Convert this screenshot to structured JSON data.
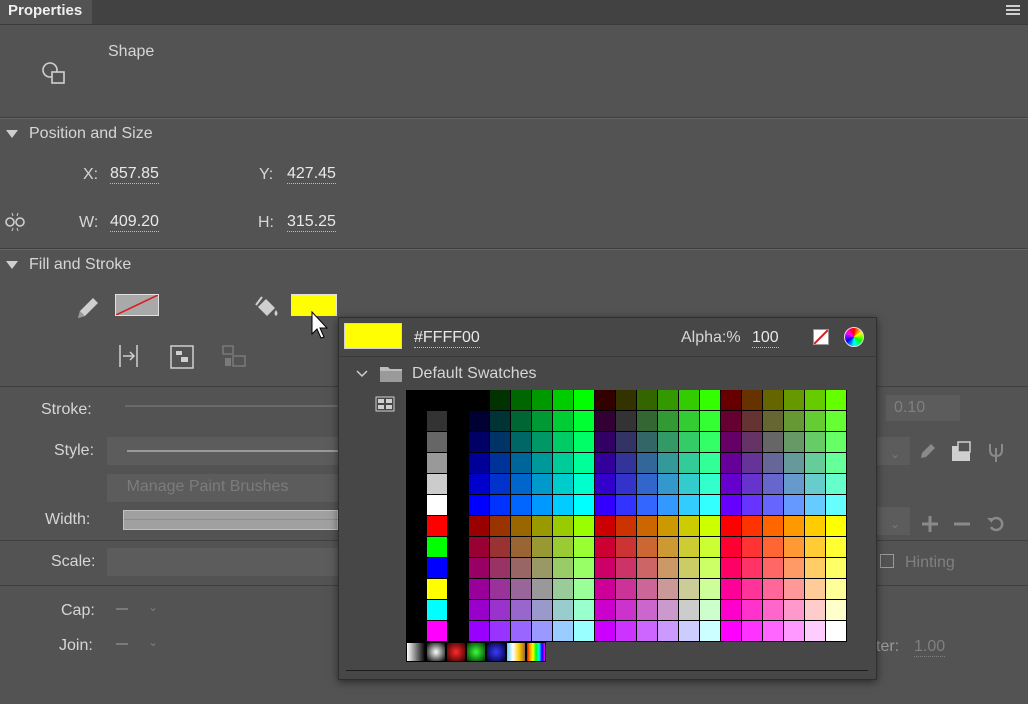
{
  "tab": {
    "title": "Properties"
  },
  "object": {
    "type_label": "Shape"
  },
  "position_size": {
    "section_title": "Position and Size",
    "x_label": "X:",
    "x_value": "857.85",
    "y_label": "Y:",
    "y_value": "427.45",
    "w_label": "W:",
    "w_value": "409.20",
    "h_label": "H:",
    "h_value": "315.25"
  },
  "fill_stroke": {
    "section_title": "Fill and Stroke",
    "stroke_label": "Stroke:",
    "stroke_value": "0.10",
    "style_label": "Style:",
    "manage_brushes": "Manage Paint Brushes",
    "width_label": "Width:",
    "scale_label": "Scale:",
    "hinting_label": "Hinting",
    "cap_label": "Cap:",
    "join_label": "Join:",
    "miter_label": "ter:",
    "miter_value": "1.00",
    "fill_color": "#FFFF00"
  },
  "swatch_popup": {
    "hex_value": "#FFFF00",
    "alpha_label": "Alpha:%",
    "alpha_value": "100",
    "swatch_group": "Default Swatches"
  },
  "colors": {
    "panel_bg": "#535353",
    "accent_fill": "#FFFF00"
  }
}
